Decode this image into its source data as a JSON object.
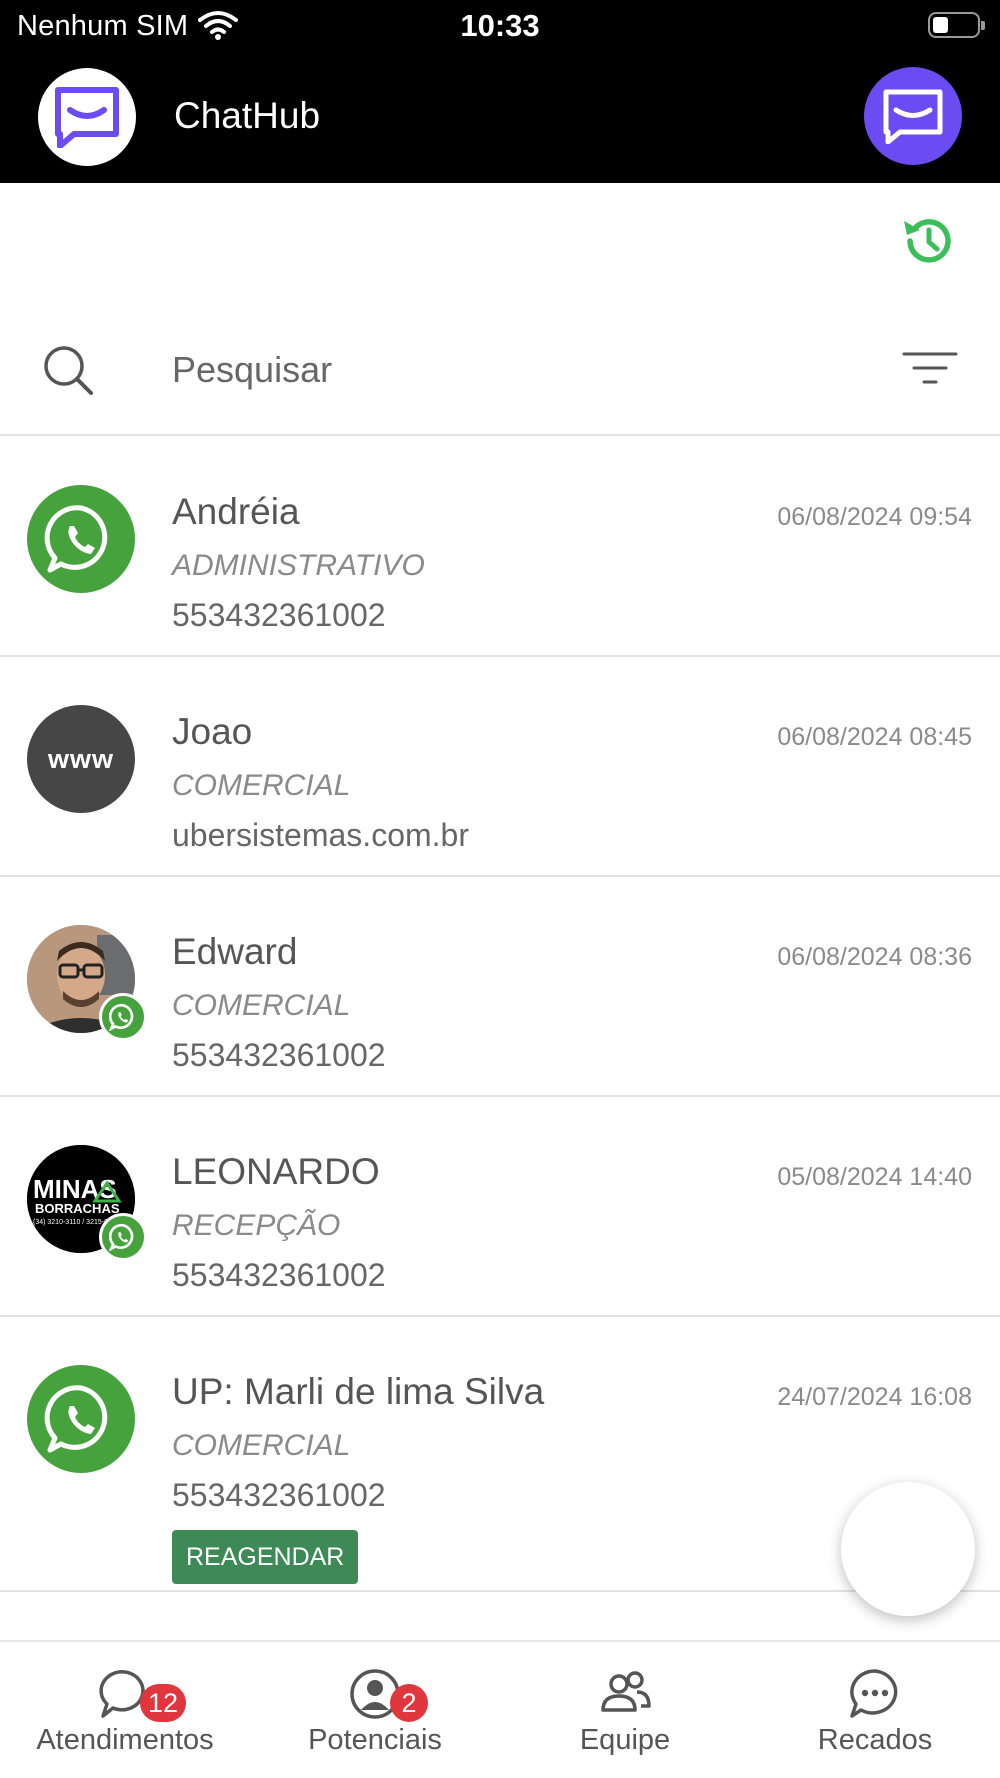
{
  "status_bar": {
    "carrier": "Nenhum SIM",
    "time": "10:33"
  },
  "header": {
    "title": "ChatHub"
  },
  "search": {
    "placeholder": "Pesquisar"
  },
  "colors": {
    "whatsapp_green": "#45a23d",
    "brand_purple": "#6b4cf2",
    "history_green": "#3cbf59",
    "badge_red": "#e0363e",
    "reagendar_green": "#3d8a57"
  },
  "conversations": [
    {
      "name": "Andréia",
      "department": "ADMINISTRATIVO",
      "contact": "553432361002",
      "datetime": "06/08/2024 09:54",
      "avatar": "whatsapp-icon"
    },
    {
      "name": "Joao",
      "department": "COMERCIAL",
      "contact": "ubersistemas.com.br",
      "datetime": "06/08/2024 08:45",
      "avatar": "www-icon",
      "avatar_text": "www"
    },
    {
      "name": "Edward",
      "department": "COMERCIAL",
      "contact": "553432361002",
      "datetime": "06/08/2024 08:36",
      "avatar": "user-photo"
    },
    {
      "name": "LEONARDO",
      "department": "RECEPÇÃO",
      "contact": "553432361002",
      "datetime": "05/08/2024 14:40",
      "avatar": "company-logo",
      "logo_text": {
        "line1": "MINAS",
        "line2": "BORRACHAS",
        "line3": "(34) 3210-3110 / 3215-0041"
      }
    },
    {
      "name": "UP: Marli de lima Silva",
      "department": "COMERCIAL",
      "contact": "553432361002",
      "datetime": "24/07/2024 16:08",
      "avatar": "whatsapp-icon",
      "action_label": "REAGENDAR"
    }
  ],
  "bottom_nav": [
    {
      "label": "Atendimentos",
      "badge": "12",
      "icon": "chat-bubble-icon"
    },
    {
      "label": "Potenciais",
      "badge": "2",
      "icon": "person-circle-icon"
    },
    {
      "label": "Equipe",
      "icon": "people-icon"
    },
    {
      "label": "Recados",
      "icon": "message-dots-icon"
    }
  ]
}
